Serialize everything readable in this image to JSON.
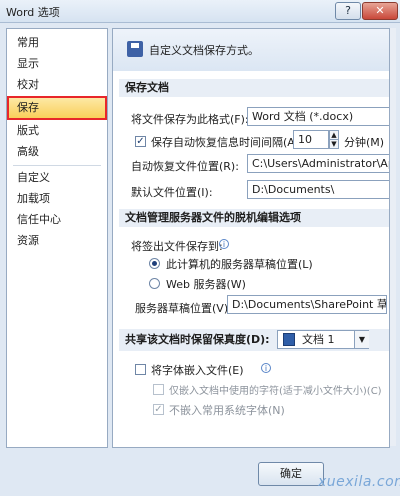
{
  "window": {
    "title": "Word 选项",
    "help_label": "?",
    "close_label": "✕"
  },
  "nav": {
    "items": [
      "常用",
      "显示",
      "校对",
      "保存",
      "版式",
      "高级",
      "自定义",
      "加载项",
      "信任中心",
      "资源"
    ],
    "selected": "保存"
  },
  "header": {
    "text": "自定义文档保存方式。",
    "icon": "save-icon"
  },
  "save_documents": {
    "section_title": "保存文档",
    "format_label": "将文件保存为此格式(F):",
    "format_value": "Word 文档 (*.docx)",
    "autorecover_check_label": "保存自动恢复信息时间间隔(A)",
    "autorecover_checked": "✓",
    "autorecover_minutes": "10",
    "minutes_label": "分钟(M)",
    "autorecover_location_label": "自动恢复文件位置(R):",
    "autorecover_location_value": "C:\\Users\\Administrator\\AppD",
    "default_location_label": "默认文件位置(I):",
    "default_location_value": "D:\\Documents\\"
  },
  "offline_editing": {
    "section_title": "文档管理服务器文件的脱机编辑选项",
    "save_to_label": "将签出文件保存到:",
    "radio_local_label": "此计算机的服务器草稿位置(L)",
    "radio_web_label": "Web 服务器(W)",
    "drafts_location_label": "服务器草稿位置(V):",
    "drafts_location_value": "D:\\Documents\\SharePoint 草稿\\"
  },
  "fidelity": {
    "section_title": "共享该文档时保留保真度(D):",
    "document_value": "文档 1",
    "embed_fonts_label": "将字体嵌入文件(E)",
    "embed_used_chars_label": "仅嵌入文档中使用的字符(适于减小文件大小)(C)",
    "no_common_fonts_label": "不嵌入常用系统字体(N)",
    "no_common_fonts_checked": "✓"
  },
  "footer": {
    "ok_label": "确定"
  },
  "watermark": "xuexila.com"
}
